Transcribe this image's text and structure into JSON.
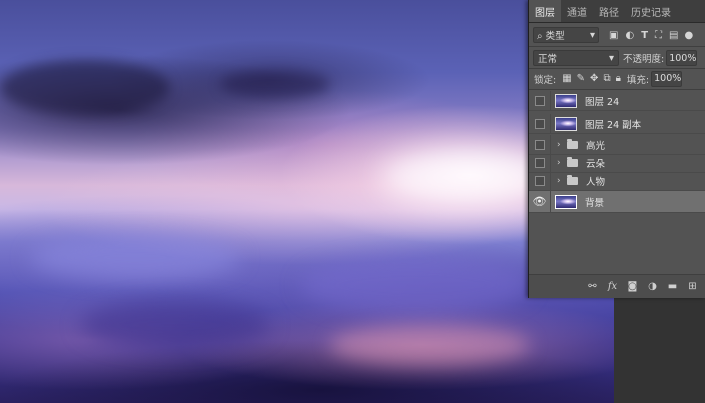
{
  "tabs": [
    {
      "label": "图层",
      "active": true
    },
    {
      "label": "通道",
      "active": false
    },
    {
      "label": "路径",
      "active": false
    },
    {
      "label": "历史记录",
      "active": false
    }
  ],
  "filter": {
    "kind_label": "类型"
  },
  "blend": {
    "mode": "正常",
    "opacity_label": "不透明度:",
    "opacity_value": "100%"
  },
  "lock": {
    "label": "锁定:",
    "fill_label": "填充:",
    "fill_value": "100%"
  },
  "layers": [
    {
      "name": "图层 24",
      "type": "image",
      "visible": false,
      "selected": false
    },
    {
      "name": "图层 24 副本",
      "type": "image",
      "visible": false,
      "selected": false
    },
    {
      "name": "高光",
      "type": "group",
      "visible": false,
      "selected": false
    },
    {
      "name": "云朵",
      "type": "group",
      "visible": false,
      "selected": false
    },
    {
      "name": "人物",
      "type": "group",
      "visible": false,
      "selected": false
    },
    {
      "name": "背景",
      "type": "image",
      "visible": true,
      "selected": true
    }
  ],
  "bottom_icons": [
    "link-icon",
    "fx-icon",
    "mask-icon",
    "adjustment-icon",
    "new-group-icon",
    "new-layer-icon"
  ],
  "colors": {
    "panel_bg": "#535353",
    "selected_row": "#707070",
    "tab_bar": "#3e3e3e"
  }
}
